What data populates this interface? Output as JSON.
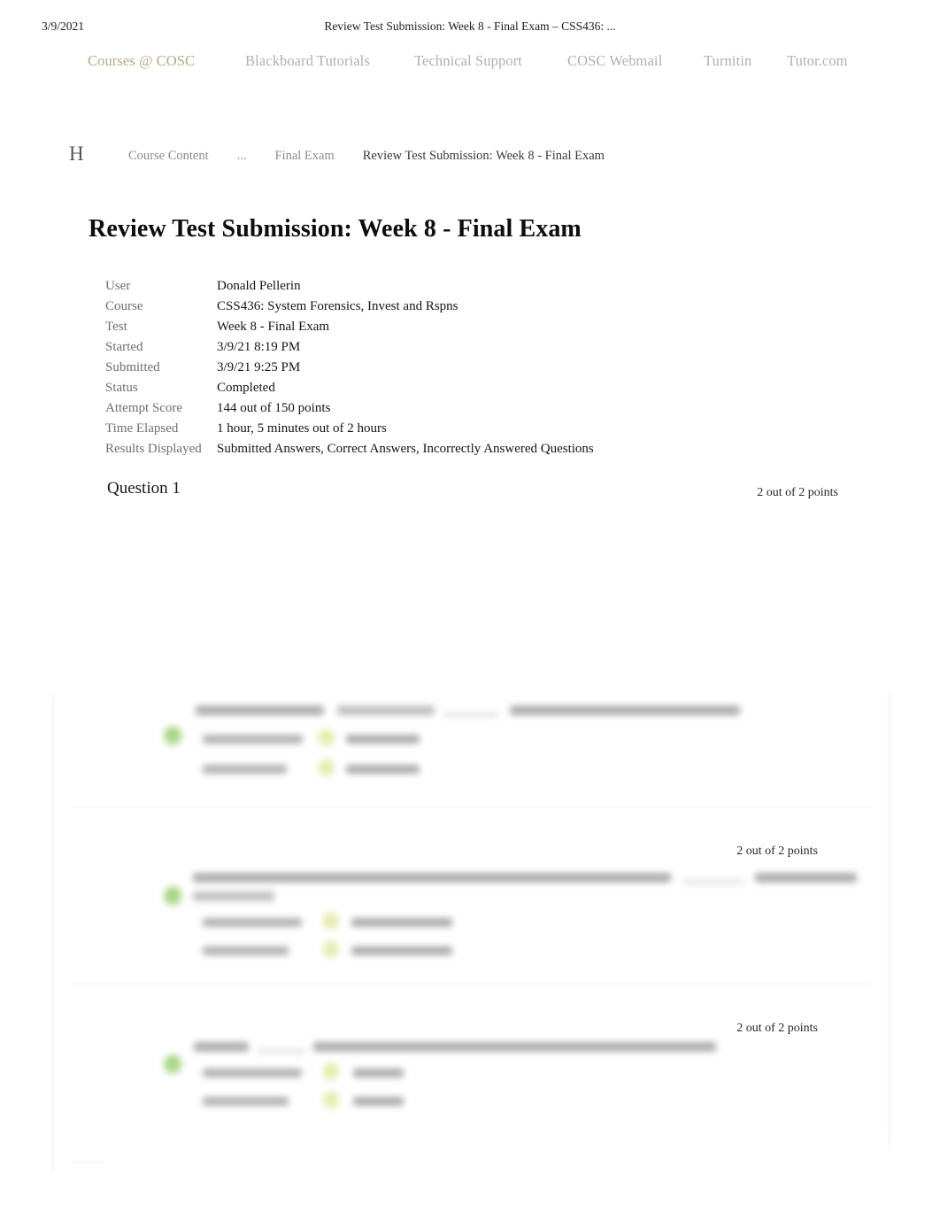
{
  "print_header": {
    "date": "3/9/2021",
    "title": "Review Test Submission: Week 8 - Final Exam – CSS436: ..."
  },
  "top_nav": {
    "items": [
      {
        "label": "Courses @ COSC",
        "accent": true
      },
      {
        "label": "Blackboard Tutorials",
        "accent": false
      },
      {
        "label": "Technical Support",
        "accent": false
      },
      {
        "label": "COSC Webmail",
        "accent": false
      },
      {
        "label": "Turnitin",
        "accent": false
      },
      {
        "label": "Tutor.com",
        "accent": false
      }
    ],
    "accent_color": "#b5ab83",
    "muted_color": "#b0b0b0"
  },
  "breadcrumb": {
    "logo": "H",
    "items": [
      {
        "label": "Course Content",
        "current": false
      },
      {
        "label": "...",
        "current": false
      },
      {
        "label": "Final Exam",
        "current": false
      },
      {
        "label": "Review Test Submission: Week 8 - Final Exam",
        "current": true
      }
    ]
  },
  "page_title": "Review Test Submission: Week 8 - Final Exam",
  "summary": {
    "rows": [
      {
        "label": "User",
        "value": "Donald Pellerin"
      },
      {
        "label": "Course",
        "value": "CSS436: System Forensics, Invest and Rspns"
      },
      {
        "label": "Test",
        "value": "Week 8 - Final Exam"
      },
      {
        "label": "Started",
        "value": "3/9/21 8:19 PM"
      },
      {
        "label": "Submitted",
        "value": "3/9/21 9:25 PM"
      },
      {
        "label": "Status",
        "value": "Completed"
      },
      {
        "label": "Attempt Score",
        "value": "144 out of 150 points"
      },
      {
        "label": "Time Elapsed",
        "value": "1 hour, 5 minutes out of 2 hours"
      },
      {
        "label": "Results Displayed",
        "value": "Submitted Answers, Correct Answers, Incorrectly Answered Questions"
      }
    ]
  },
  "question_1": {
    "label": "Question 1",
    "points": "2 out of 2 points"
  },
  "questions": [
    {
      "points": ""
    },
    {
      "points": "2 out of 2 points"
    },
    {
      "points": "2 out of 2 points"
    }
  ],
  "status_colors": {
    "correct_green": "#7bc24a",
    "answer_marker": "#d6e27a"
  }
}
